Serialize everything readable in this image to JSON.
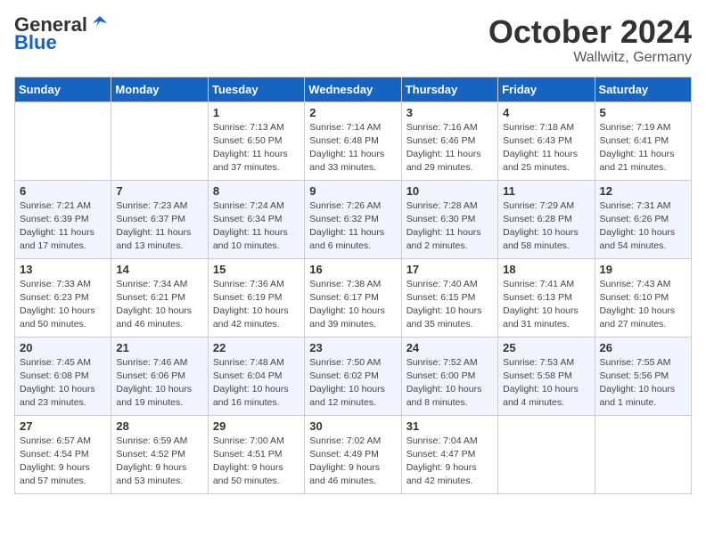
{
  "header": {
    "logo_general": "General",
    "logo_blue": "Blue",
    "month": "October 2024",
    "location": "Wallwitz, Germany"
  },
  "weekdays": [
    "Sunday",
    "Monday",
    "Tuesday",
    "Wednesday",
    "Thursday",
    "Friday",
    "Saturday"
  ],
  "weeks": [
    [
      {
        "day": "",
        "info": ""
      },
      {
        "day": "",
        "info": ""
      },
      {
        "day": "1",
        "info": "Sunrise: 7:13 AM\nSunset: 6:50 PM\nDaylight: 11 hours and 37 minutes."
      },
      {
        "day": "2",
        "info": "Sunrise: 7:14 AM\nSunset: 6:48 PM\nDaylight: 11 hours and 33 minutes."
      },
      {
        "day": "3",
        "info": "Sunrise: 7:16 AM\nSunset: 6:46 PM\nDaylight: 11 hours and 29 minutes."
      },
      {
        "day": "4",
        "info": "Sunrise: 7:18 AM\nSunset: 6:43 PM\nDaylight: 11 hours and 25 minutes."
      },
      {
        "day": "5",
        "info": "Sunrise: 7:19 AM\nSunset: 6:41 PM\nDaylight: 11 hours and 21 minutes."
      }
    ],
    [
      {
        "day": "6",
        "info": "Sunrise: 7:21 AM\nSunset: 6:39 PM\nDaylight: 11 hours and 17 minutes."
      },
      {
        "day": "7",
        "info": "Sunrise: 7:23 AM\nSunset: 6:37 PM\nDaylight: 11 hours and 13 minutes."
      },
      {
        "day": "8",
        "info": "Sunrise: 7:24 AM\nSunset: 6:34 PM\nDaylight: 11 hours and 10 minutes."
      },
      {
        "day": "9",
        "info": "Sunrise: 7:26 AM\nSunset: 6:32 PM\nDaylight: 11 hours and 6 minutes."
      },
      {
        "day": "10",
        "info": "Sunrise: 7:28 AM\nSunset: 6:30 PM\nDaylight: 11 hours and 2 minutes."
      },
      {
        "day": "11",
        "info": "Sunrise: 7:29 AM\nSunset: 6:28 PM\nDaylight: 10 hours and 58 minutes."
      },
      {
        "day": "12",
        "info": "Sunrise: 7:31 AM\nSunset: 6:26 PM\nDaylight: 10 hours and 54 minutes."
      }
    ],
    [
      {
        "day": "13",
        "info": "Sunrise: 7:33 AM\nSunset: 6:23 PM\nDaylight: 10 hours and 50 minutes."
      },
      {
        "day": "14",
        "info": "Sunrise: 7:34 AM\nSunset: 6:21 PM\nDaylight: 10 hours and 46 minutes."
      },
      {
        "day": "15",
        "info": "Sunrise: 7:36 AM\nSunset: 6:19 PM\nDaylight: 10 hours and 42 minutes."
      },
      {
        "day": "16",
        "info": "Sunrise: 7:38 AM\nSunset: 6:17 PM\nDaylight: 10 hours and 39 minutes."
      },
      {
        "day": "17",
        "info": "Sunrise: 7:40 AM\nSunset: 6:15 PM\nDaylight: 10 hours and 35 minutes."
      },
      {
        "day": "18",
        "info": "Sunrise: 7:41 AM\nSunset: 6:13 PM\nDaylight: 10 hours and 31 minutes."
      },
      {
        "day": "19",
        "info": "Sunrise: 7:43 AM\nSunset: 6:10 PM\nDaylight: 10 hours and 27 minutes."
      }
    ],
    [
      {
        "day": "20",
        "info": "Sunrise: 7:45 AM\nSunset: 6:08 PM\nDaylight: 10 hours and 23 minutes."
      },
      {
        "day": "21",
        "info": "Sunrise: 7:46 AM\nSunset: 6:06 PM\nDaylight: 10 hours and 19 minutes."
      },
      {
        "day": "22",
        "info": "Sunrise: 7:48 AM\nSunset: 6:04 PM\nDaylight: 10 hours and 16 minutes."
      },
      {
        "day": "23",
        "info": "Sunrise: 7:50 AM\nSunset: 6:02 PM\nDaylight: 10 hours and 12 minutes."
      },
      {
        "day": "24",
        "info": "Sunrise: 7:52 AM\nSunset: 6:00 PM\nDaylight: 10 hours and 8 minutes."
      },
      {
        "day": "25",
        "info": "Sunrise: 7:53 AM\nSunset: 5:58 PM\nDaylight: 10 hours and 4 minutes."
      },
      {
        "day": "26",
        "info": "Sunrise: 7:55 AM\nSunset: 5:56 PM\nDaylight: 10 hours and 1 minute."
      }
    ],
    [
      {
        "day": "27",
        "info": "Sunrise: 6:57 AM\nSunset: 4:54 PM\nDaylight: 9 hours and 57 minutes."
      },
      {
        "day": "28",
        "info": "Sunrise: 6:59 AM\nSunset: 4:52 PM\nDaylight: 9 hours and 53 minutes."
      },
      {
        "day": "29",
        "info": "Sunrise: 7:00 AM\nSunset: 4:51 PM\nDaylight: 9 hours and 50 minutes."
      },
      {
        "day": "30",
        "info": "Sunrise: 7:02 AM\nSunset: 4:49 PM\nDaylight: 9 hours and 46 minutes."
      },
      {
        "day": "31",
        "info": "Sunrise: 7:04 AM\nSunset: 4:47 PM\nDaylight: 9 hours and 42 minutes."
      },
      {
        "day": "",
        "info": ""
      },
      {
        "day": "",
        "info": ""
      }
    ]
  ]
}
